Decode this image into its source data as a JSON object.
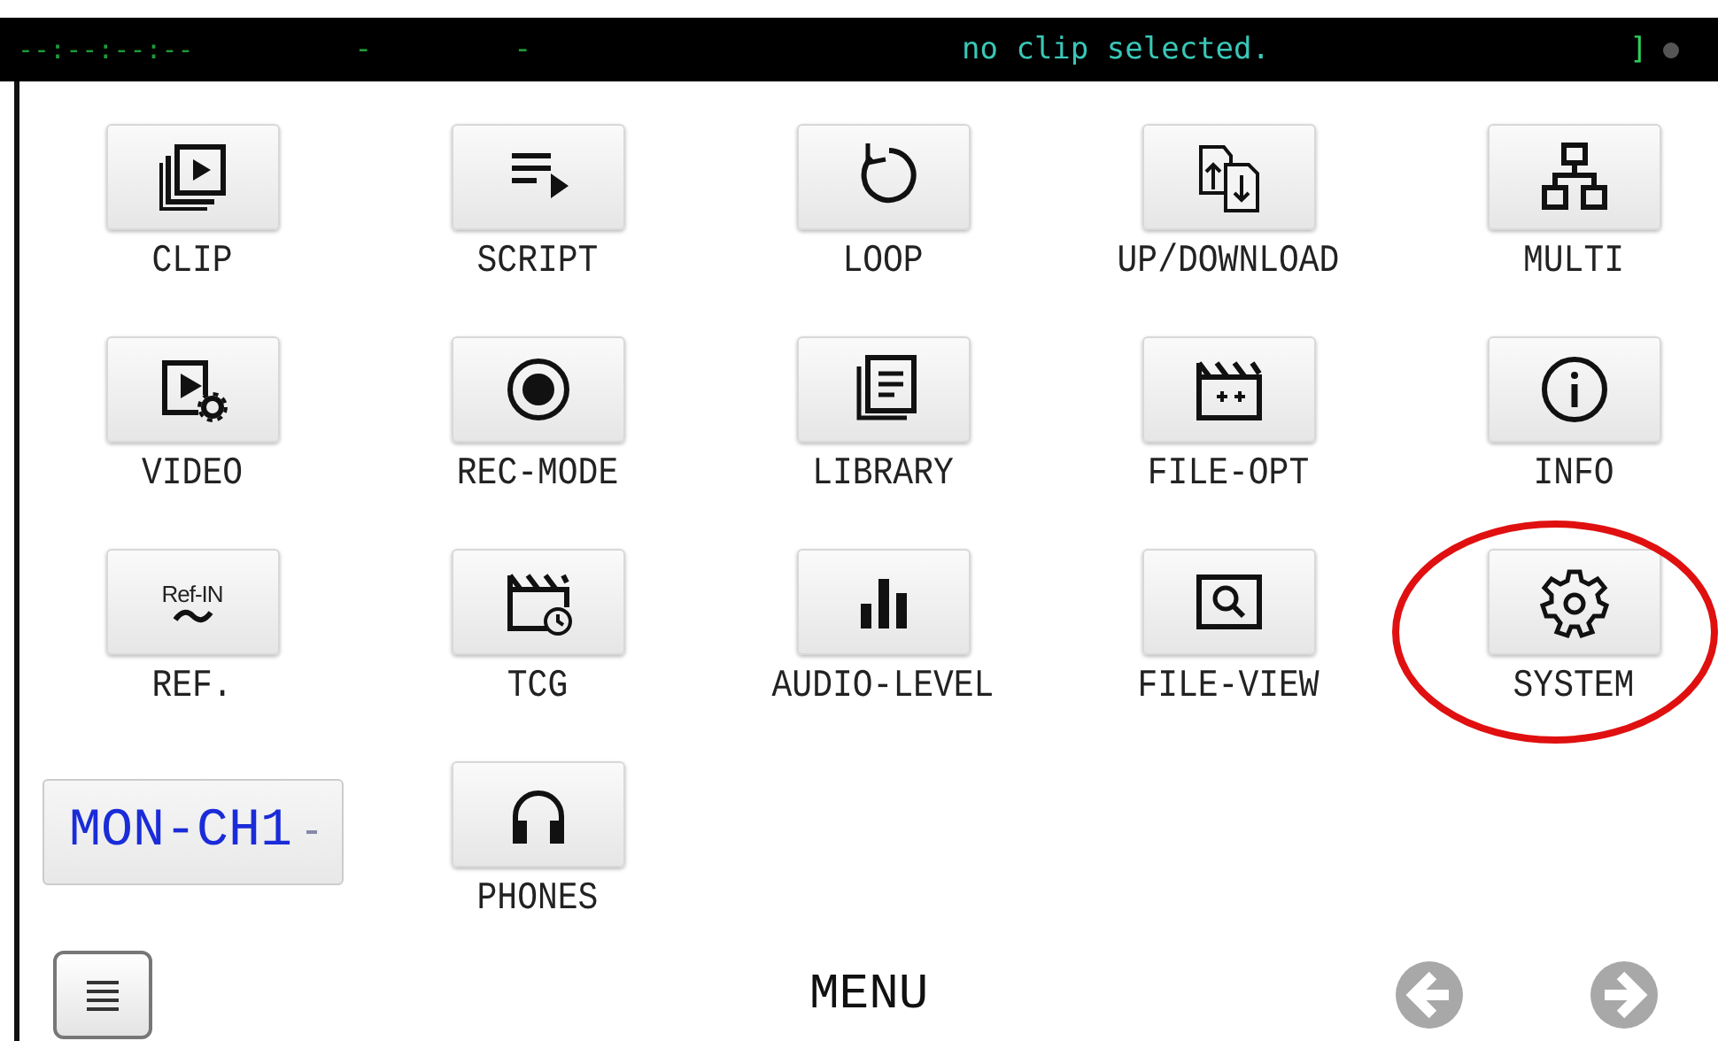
{
  "status_bar": {
    "timecode": "--:--:--:--",
    "field_2": "-",
    "field_3": "-",
    "message": "no clip selected.",
    "indicator": "]"
  },
  "menu_buttons": [
    {
      "label": "CLIP",
      "kind": "clip",
      "highlighted": false
    },
    {
      "label": "SCRIPT",
      "kind": "script",
      "highlighted": false
    },
    {
      "label": "LOOP",
      "kind": "loop",
      "highlighted": false
    },
    {
      "label": "UP/DOWNLOAD",
      "kind": "updown",
      "highlighted": false
    },
    {
      "label": "MULTI",
      "kind": "multi",
      "highlighted": false
    },
    {
      "label": "VIDEO",
      "kind": "video",
      "highlighted": false
    },
    {
      "label": "REC-MODE",
      "kind": "rec",
      "highlighted": false
    },
    {
      "label": "LIBRARY",
      "kind": "library",
      "highlighted": false
    },
    {
      "label": "FILE-OPT",
      "kind": "fileopt",
      "highlighted": false
    },
    {
      "label": "INFO",
      "kind": "info",
      "highlighted": false
    },
    {
      "label": "REF.",
      "kind": "ref",
      "icon_text": "Ref-IN",
      "highlighted": false
    },
    {
      "label": "TCG",
      "kind": "tcg",
      "highlighted": false
    },
    {
      "label": "AUDIO-LEVEL",
      "kind": "audio",
      "highlighted": false
    },
    {
      "label": "FILE-VIEW",
      "kind": "fileview",
      "highlighted": false
    },
    {
      "label": "SYSTEM",
      "kind": "system",
      "highlighted": true
    }
  ],
  "monitor_select": {
    "value": "MON-CH1"
  },
  "extra_buttons": [
    {
      "label": "PHONES",
      "kind": "phones",
      "highlighted": false
    }
  ],
  "bottom_bar": {
    "title": "MENU"
  }
}
